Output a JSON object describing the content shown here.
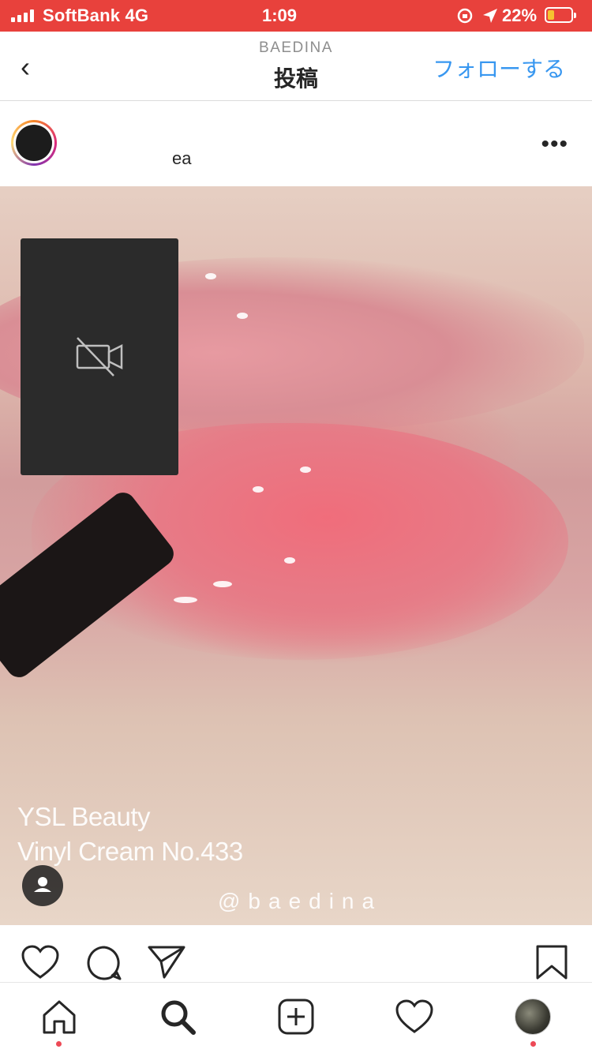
{
  "status_bar": {
    "carrier": "SoftBank 4G",
    "time": "1:09",
    "battery": "22%",
    "battery_fill": 0.22
  },
  "header": {
    "back_icon": "chevron-left-icon",
    "account": "BAEDINA",
    "title": "投稿",
    "follow_label": "フォローする"
  },
  "post": {
    "username_fragment": "ea",
    "more_icon": "more-horizontal-icon"
  },
  "video": {
    "caption_line1": "YSL Beauty",
    "caption_line2": "Vinyl Cream No.433",
    "watermark": "@baedina",
    "camera_overlay_icon": "video-off-icon",
    "user_tag_icon": "person-icon"
  },
  "actions": [
    "heart-icon",
    "comment-icon",
    "share-icon",
    "bookmark-icon"
  ],
  "tabs": [
    "home-icon",
    "search-icon",
    "add-icon",
    "activity-icon",
    "profile-icon"
  ],
  "colors": {
    "status_bar": "#e8413c",
    "link": "#3897f0",
    "notification_dot": "#ed4956"
  }
}
